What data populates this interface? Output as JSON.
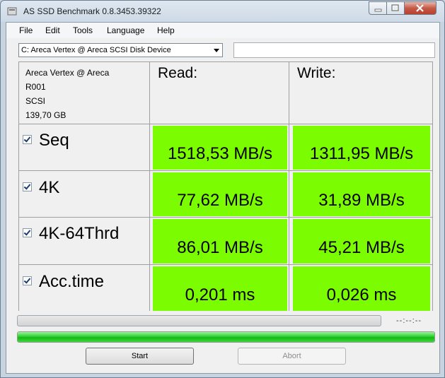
{
  "window": {
    "title": "AS SSD Benchmark 0.8.3453.39322"
  },
  "menu": [
    "File",
    "Edit",
    "Tools",
    "Language",
    "Help"
  ],
  "drive": {
    "selected": "C: Areca Vertex @ Areca SCSI Disk Device",
    "extra_value": ""
  },
  "device_info": [
    "Areca Vertex @ Areca",
    "R001",
    "SCSI",
    "139,70 GB"
  ],
  "columns": {
    "read": "Read:",
    "write": "Write:"
  },
  "rows": [
    {
      "label": "Seq",
      "checked": true,
      "read": "1518,53 MB/s",
      "write": "1311,95 MB/s"
    },
    {
      "label": "4K",
      "checked": true,
      "read": "77,62 MB/s",
      "write": "31,89 MB/s"
    },
    {
      "label": "4K-64Thrd",
      "checked": true,
      "read": "86,01 MB/s",
      "write": "45,21 MB/s"
    },
    {
      "label": "Acc.time",
      "checked": true,
      "read": "0,201 ms",
      "write": "0,026 ms"
    }
  ],
  "timer": "--:--:--",
  "progress": {
    "overall_fraction": 1.0,
    "current_fraction": 0.0
  },
  "buttons": {
    "start": "Start",
    "abort": "Abort"
  },
  "colors": {
    "result_bg": "#7cfc00",
    "progress_green": "#2ed22e"
  }
}
